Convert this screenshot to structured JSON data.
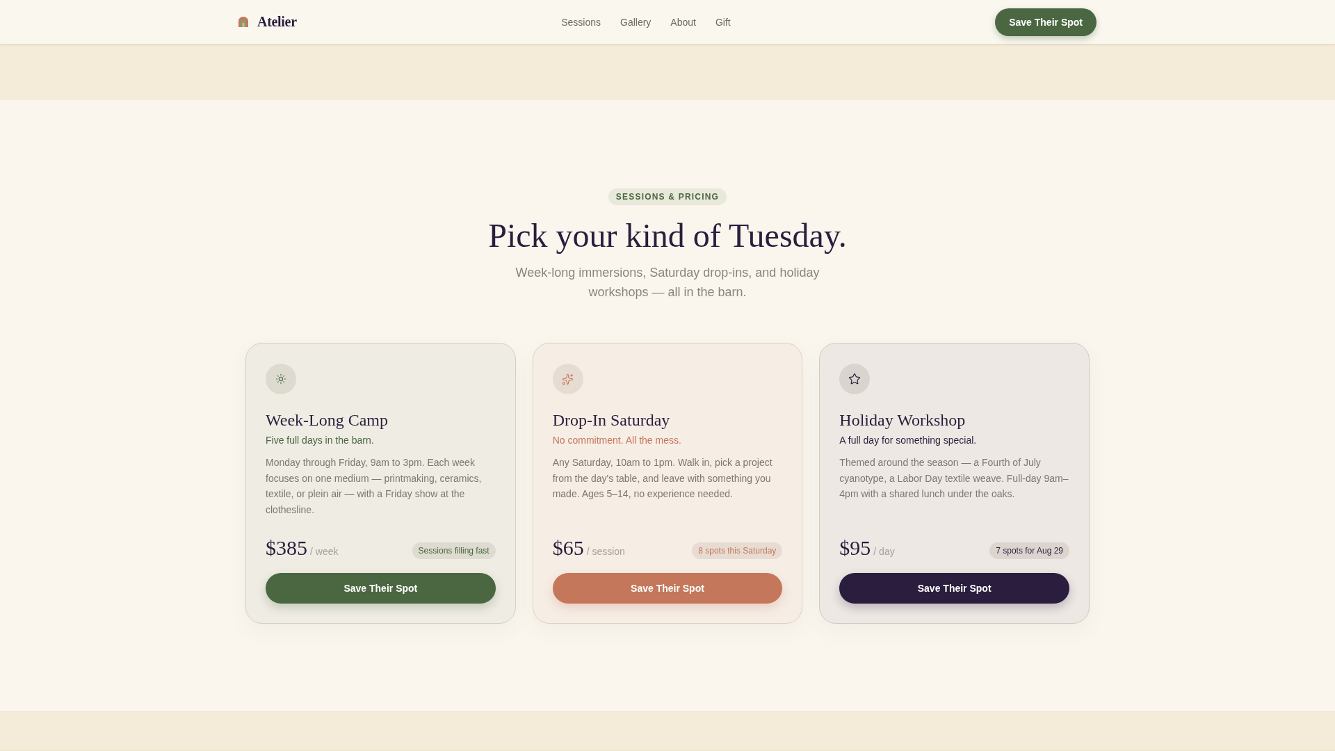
{
  "header": {
    "logo": "Atelier",
    "nav": [
      "Sessions",
      "Gallery",
      "About",
      "Gift"
    ],
    "cta": "Save Their Spot"
  },
  "pricing": {
    "eyebrow": "SESSIONS & PRICING",
    "title": "Pick your kind of Tuesday.",
    "subtitle": "Week-long immersions, Saturday drop-ins, and holiday workshops — all in the barn.",
    "plans": [
      {
        "kind": "camp",
        "color": "#4a6741",
        "name": "Week-Long Camp",
        "tagline": "Five full days in the barn.",
        "description": "Monday through Friday, 9am to 3pm. Each week focuses on one medium — printmaking, ceramics, textile, or plein air — with a Friday show at the clothesline.",
        "price": "$385",
        "unit": "/ week",
        "availability": "Sessions filling fast",
        "button": "Save Their Spot"
      },
      {
        "kind": "dropin",
        "color": "#c4775a",
        "name": "Drop-In Saturday",
        "tagline": "No commitment. All the mess.",
        "description": "Any Saturday, 10am to 1pm. Walk in, pick a project from the day's table, and leave with something you made. Ages 5–14, no experience needed.",
        "price": "$65",
        "unit": "/ session",
        "availability": "8 spots this Saturday",
        "button": "Save Their Spot"
      },
      {
        "kind": "holiday",
        "color": "#2b1d3d",
        "name": "Holiday Workshop",
        "tagline": "A full day for something special.",
        "description": "Themed around the season — a Fourth of July cyanotype, a Labor Day textile weave. Full-day 9am–4pm with a shared lunch under the oaks.",
        "price": "$95",
        "unit": "/ day",
        "availability": "7 spots for Aug 29",
        "button": "Save Their Spot"
      }
    ]
  }
}
